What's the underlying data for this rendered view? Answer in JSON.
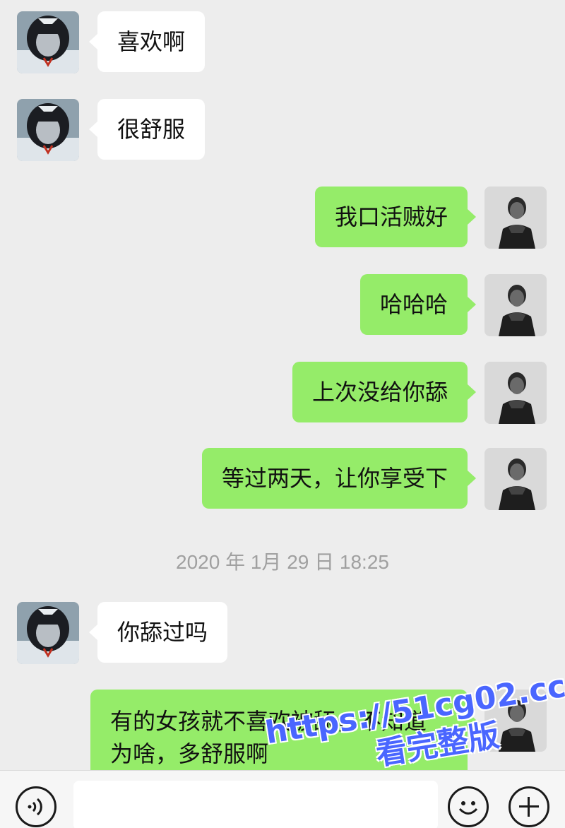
{
  "messages": [
    {
      "side": "in",
      "text": "喜欢啊"
    },
    {
      "side": "in",
      "text": "很舒服"
    },
    {
      "side": "out",
      "text": "我口活贼好"
    },
    {
      "side": "out",
      "text": "哈哈哈"
    },
    {
      "side": "out",
      "text": "上次没给你舔"
    },
    {
      "side": "out",
      "text": "等过两天，让你享受下"
    },
    {
      "side": "in",
      "text": "你舔过吗"
    },
    {
      "side": "out",
      "text": "有的女孩就不喜欢被舔，不知道为啥，多舒服啊"
    }
  ],
  "timestamp": "2020 年 1月 29 日 18:25",
  "input": {
    "placeholder": ""
  },
  "toolbar_icons": [
    "voice-icon",
    "emoji-icon",
    "plus-icon"
  ],
  "watermark": {
    "url": "https://51cg02.cc",
    "sub": "看完整版"
  },
  "colors": {
    "background": "#ededed",
    "incoming_bubble": "#ffffff",
    "outgoing_bubble": "#95ec69",
    "watermark": "#4a66ff"
  }
}
